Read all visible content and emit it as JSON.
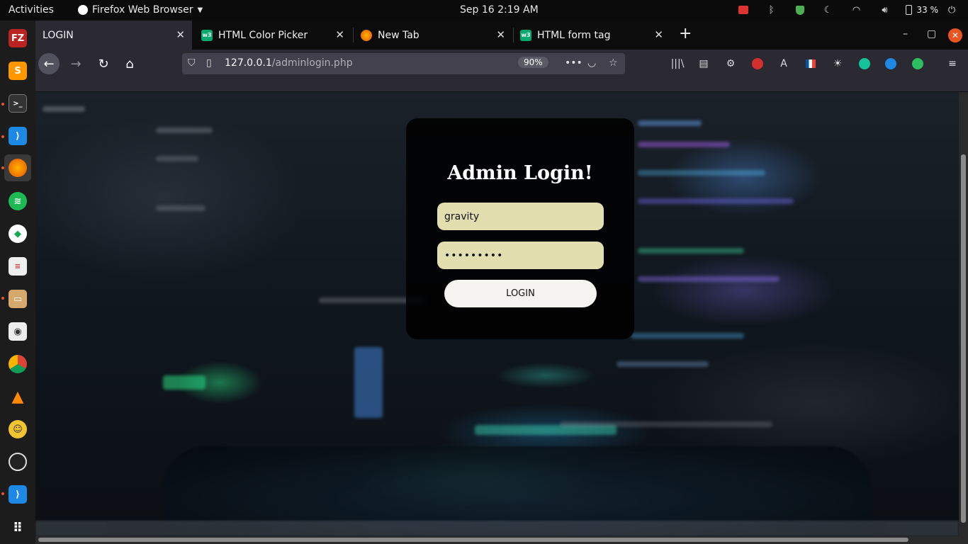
{
  "topbar": {
    "activities": "Activities",
    "app_name": "Firefox Web Browser",
    "clock": "Sep 16   2:19 AM",
    "battery": "33 %"
  },
  "browser": {
    "tabs": [
      {
        "label": "LOGIN",
        "active": true
      },
      {
        "label": "HTML Color Picker",
        "active": false,
        "favicon": "w3"
      },
      {
        "label": "New Tab",
        "active": false
      },
      {
        "label": "HTML form tag",
        "active": false,
        "favicon": "w3"
      }
    ],
    "url_host": "127.0.0.1",
    "url_path": "/adminlogin.php",
    "zoom": "90%"
  },
  "login": {
    "title": "Admin Login!",
    "username_value": "gravity",
    "password_value": "sdfghjkly",
    "button_label": "LOGIN"
  },
  "colors": {
    "accent": "#e95420",
    "input_bg": "#e2deb0",
    "card_bg": "#000000"
  }
}
